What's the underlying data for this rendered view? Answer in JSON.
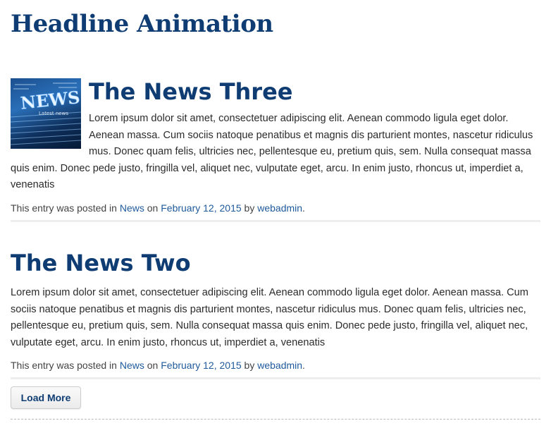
{
  "page": {
    "title": "Headline Animation"
  },
  "posts": [
    {
      "title": "The News Three",
      "thumbnail_text": "NEWS",
      "excerpt": "Lorem ipsum dolor sit amet, consectetuer adipiscing elit. Aenean commodo ligula eget dolor. Aenean massa. Cum sociis natoque penatibus et magnis dis parturient montes, nascetur ridiculus mus. Donec quam felis, ultricies nec, pellentesque eu, pretium quis, sem. Nulla consequat massa quis enim. Donec pede justo, fringilla vel, aliquet nec, vulputate eget, arcu. In enim justo, rhoncus ut, imperdiet a, venenatis",
      "meta": {
        "prefix": "This entry was posted in",
        "category": "News",
        "on": "on",
        "date": "February 12, 2015",
        "by": "by",
        "author": "webadmin",
        "suffix": "."
      }
    },
    {
      "title": "The News Two",
      "excerpt": "Lorem ipsum dolor sit amet, consectetuer adipiscing elit. Aenean commodo ligula eget dolor. Aenean massa. Cum sociis natoque penatibus et magnis dis parturient montes, nascetur ridiculus mus. Donec quam felis, ultricies nec, pellentesque eu, pretium quis, sem. Nulla consequat massa quis enim. Donec pede justo, fringilla vel, aliquet nec, vulputate eget, arcu. In enim justo, rhoncus ut, imperdiet a, venenatis",
      "meta": {
        "prefix": "This entry was posted in",
        "category": "News",
        "on": "on",
        "date": "February 12, 2015",
        "by": "by",
        "author": "webadmin",
        "suffix": "."
      }
    }
  ],
  "load_more": {
    "label": "Load More"
  },
  "colors": {
    "heading": "#0f3d73",
    "link": "#1f5a9c",
    "text": "#2b2b2b"
  }
}
